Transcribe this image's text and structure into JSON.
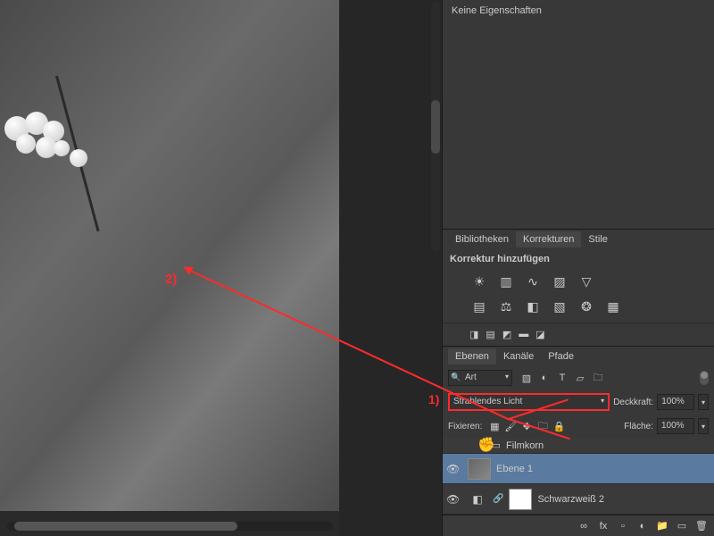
{
  "properties": {
    "title": "Keine Eigenschaften"
  },
  "biblio_tabs": {
    "bibliotheken": "Bibliotheken",
    "korrekturen": "Korrekturen",
    "stile": "Stile"
  },
  "korrektur_label": "Korrektur hinzufügen",
  "ebenen_tabs": {
    "ebenen": "Ebenen",
    "kanaele": "Kanäle",
    "pfade": "Pfade"
  },
  "filter": {
    "label": "Art"
  },
  "blend": {
    "mode": "Strahlendes Licht",
    "deckkraft_label": "Deckkraft:",
    "deckkraft_value": "100%"
  },
  "lock": {
    "label": "Fixieren:",
    "flaeche_label": "Fläche:",
    "flaeche_value": "100%"
  },
  "layers": {
    "group_hint": "Filmkorn",
    "layer1_name": "Ebene 1",
    "adj_name": "Schwarzweiß 2"
  },
  "footer_icons": [
    "∞",
    "fx",
    "▫",
    "◐",
    "▭",
    "📁",
    "➕",
    "🗑"
  ],
  "annotations": {
    "a1": "1)",
    "a2": "2)"
  },
  "chart_data": null
}
